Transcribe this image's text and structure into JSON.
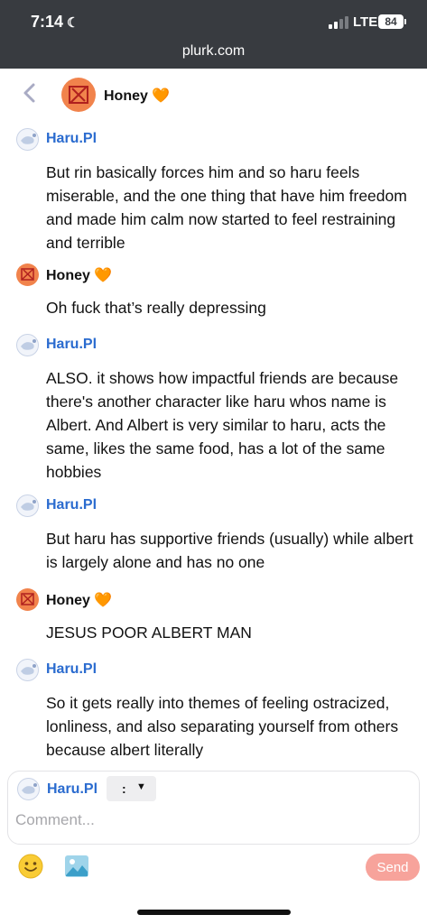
{
  "status_bar": {
    "time": "7:14",
    "network": "LTE",
    "battery": "84"
  },
  "browser": {
    "url": "plurk.com"
  },
  "header": {
    "title": "Honey 🧡"
  },
  "messages": [
    {
      "author": "Haru.Pl",
      "text": "But rin basically forces him and so haru feels miserable, and the one thing that have him freedom and made him calm now started to feel restraining and terrible"
    },
    {
      "author": "Honey 🧡",
      "text": "Oh fuck that’s really depressing"
    },
    {
      "author": "Haru.Pl",
      "text": "ALSO. it shows how impactful friends are because there's another character like haru whos name is Albert. And Albert is very similar to haru, acts the same, likes the same food, has a lot of the same hobbies"
    },
    {
      "author": "Haru.Pl",
      "text": "But haru has supportive friends (usually) while albert is largely alone and has no one"
    },
    {
      "author": "Honey 🧡",
      "text": "JESUS POOR ALBERT MAN"
    },
    {
      "author": "Haru.Pl",
      "text": "So it gets really into themes of feeling ostracized, lonliness, and also separating yourself from others because albert literally"
    }
  ],
  "composer": {
    "author": "Haru.Pl",
    "qualifier": ":",
    "placeholder": "Comment...",
    "send_label": "Send"
  },
  "colors": {
    "link_blue": "#2a6bcf",
    "send_button": "#f7a39b",
    "chrome": "#383b40"
  }
}
